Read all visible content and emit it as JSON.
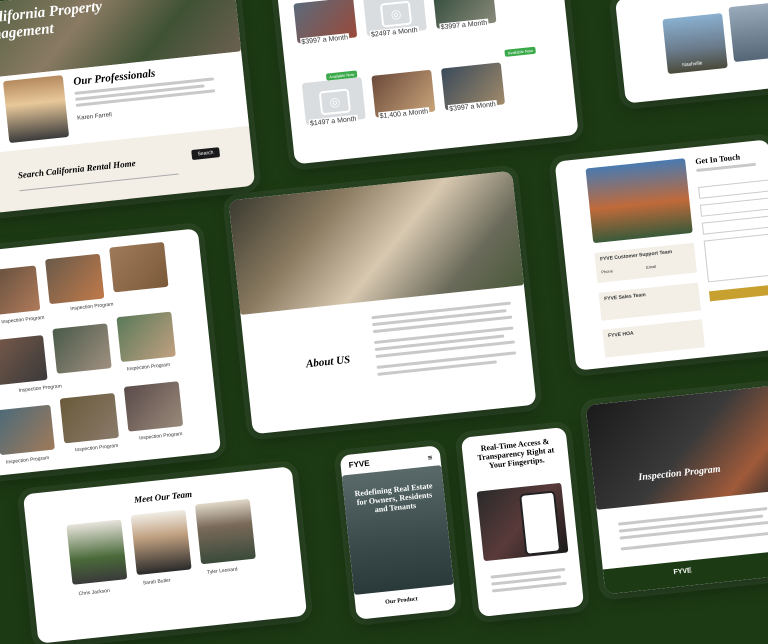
{
  "brand": "FYVE",
  "card1": {
    "title_line1": "alifornia Property",
    "title_line2": "nagement",
    "section": "Our Professionals",
    "person_name": "Karen Farrell",
    "search_title": "Search California Rental Home",
    "search_button": "Search"
  },
  "card2": {
    "prices": [
      "$3997 a Month",
      "$2497 a Month",
      "$3997 a Month",
      "$1497 a Month",
      "$1,400 a Month",
      "$3997 a Month"
    ],
    "badge": "Available Now"
  },
  "card3": {
    "city_label": "Nashville"
  },
  "card4": {
    "labels": [
      "Inspection Program",
      "Inspection Program",
      "Inspection Program",
      "Inspection Program",
      "Inspection Program",
      "Inspection Program",
      "Inspection Program",
      "Inspection Program",
      "Inspection Program"
    ]
  },
  "card5": {
    "section": "About US"
  },
  "card6": {
    "title": "Get In Touch",
    "team1": "FYVE Customer Support Team",
    "team2": "FYVE Sales Team",
    "team3": "FYVE HOA",
    "phone": "Phone",
    "email": "Email"
  },
  "card7": {
    "title": "Meet Our Team",
    "member1": "Sarah Butler",
    "member2": "Tyler Leonard",
    "member3": "Chris Jackson"
  },
  "card8": {
    "hero": "Redefining Real Estate for Owners, Residents and Tenants",
    "footer": "Our Product"
  },
  "card9": {
    "headline": "Real-Time Access & Transparency Right at Your Fingertips."
  },
  "card10": {
    "hero": "Inspection Program"
  }
}
